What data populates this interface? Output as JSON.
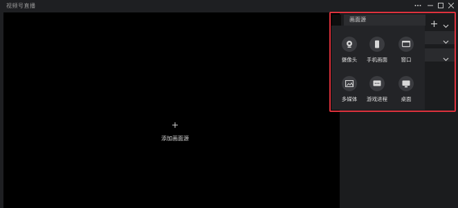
{
  "app": {
    "title": "视频号直播"
  },
  "window_controls": [
    "more-icon",
    "minimize-icon",
    "maximize-icon",
    "close-icon"
  ],
  "preview": {
    "add_source_label": "添加画面源"
  },
  "source_panel": {
    "header": "画面源",
    "items": [
      {
        "label": "摄像头",
        "icon": "camera-icon"
      },
      {
        "label": "手机画面",
        "icon": "phone-icon"
      },
      {
        "label": "窗口",
        "icon": "window-icon"
      },
      {
        "label": "多媒体",
        "icon": "image-icon"
      },
      {
        "label": "游戏进程",
        "icon": "game-icon"
      },
      {
        "label": "桌面",
        "icon": "desktop-icon"
      }
    ]
  },
  "colors": {
    "highlight": "#e0323d",
    "background": "#1e1f22",
    "preview": "#000000"
  }
}
